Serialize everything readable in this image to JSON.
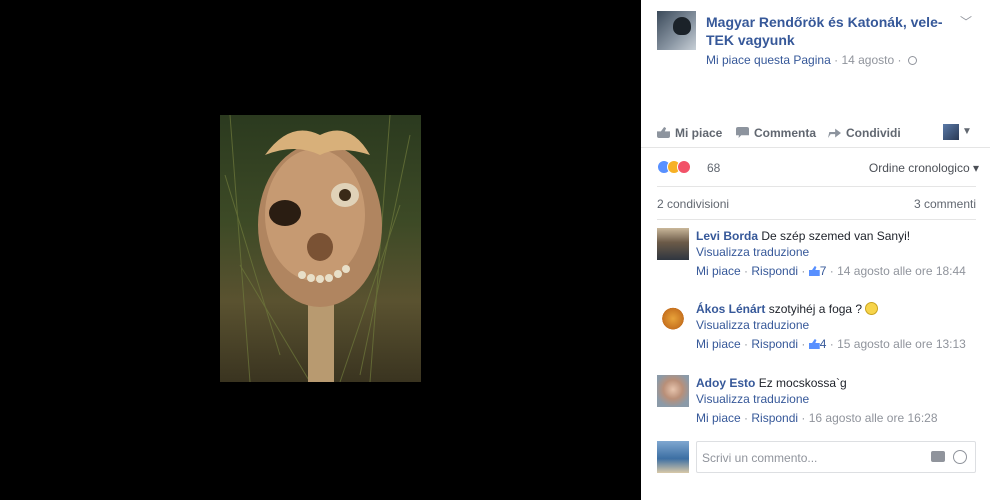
{
  "post": {
    "page_name": "Magyar Rendőrök és Katonák, vele-TEK vagyunk",
    "like_page": "Mi piace questa Pagina",
    "date": "14 agosto",
    "dot": "·"
  },
  "actions": {
    "like": "Mi piace",
    "comment": "Commenta",
    "share": "Condividi"
  },
  "reactions": {
    "count": "68",
    "order": "Ordine cronologico ▾"
  },
  "stats": {
    "shares": "2 condivisioni",
    "comments": "3 commenti"
  },
  "comments": [
    {
      "author": "Levi Borda",
      "text": "De szép szemed van Sanyi!",
      "translate": "Visualizza traduzione",
      "like": "Mi piace",
      "reply": "Rispondi",
      "likes": "7",
      "time": "14 agosto alle ore 18:44"
    },
    {
      "author": "Ákos Lénárt",
      "text": "szotyihéj a foga ?",
      "translate": "Visualizza traduzione",
      "like": "Mi piace",
      "reply": "Rispondi",
      "likes": "4",
      "time": "15 agosto alle ore 13:13"
    },
    {
      "author": "Adoy Esto",
      "text": "Ez mocskossa`g",
      "translate": "Visualizza traduzione",
      "like": "Mi piace",
      "reply": "Rispondi",
      "time": "16 agosto alle ore 16:28"
    }
  ],
  "reply": {
    "placeholder": "Scrivi un commento..."
  },
  "sep": " · "
}
